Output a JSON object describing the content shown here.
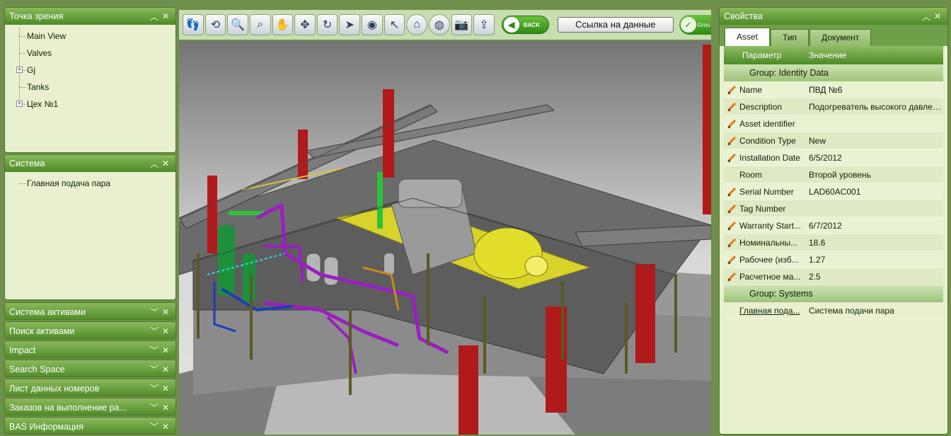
{
  "left_panels": {
    "viewpoints": {
      "title": "Точка зрения",
      "items": [
        {
          "label": "Main View",
          "expandable": false
        },
        {
          "label": "Valves",
          "expandable": false
        },
        {
          "label": "Gj",
          "expandable": true
        },
        {
          "label": "Tanks",
          "expandable": false
        },
        {
          "label": "Цех №1",
          "expandable": true
        }
      ]
    },
    "system": {
      "title": "Система",
      "items": [
        {
          "label": "Главная подача пара"
        }
      ]
    },
    "collapsed": [
      "Система активами",
      "Поиск активами",
      "Impact",
      "Search Space",
      "Лист данных номеров",
      "Заказов на выполнение ра...",
      "BAS Информация"
    ]
  },
  "toolbar": {
    "icons": [
      "walk-icon",
      "orbit-icon",
      "zoom-icon",
      "zoom-window-icon",
      "pan-icon",
      "navigate-icon",
      "rotate-icon",
      "select-icon",
      "layers-icon",
      "pointer-icon",
      "home-icon",
      "sphere-icon",
      "camera-icon",
      "export-icon"
    ],
    "back_label": "BACK",
    "data_link_label": "Ссылка на данные",
    "group_label": "Grou"
  },
  "properties": {
    "title": "Свойства",
    "tabs": [
      "Asset",
      "Тип",
      "Документ"
    ],
    "active_tab": 0,
    "columns": {
      "param": "Параметр",
      "value": "Значение"
    },
    "groups": [
      {
        "title": "Group: Identity Data",
        "rows": [
          {
            "key": "Name",
            "value": "ПВД №6",
            "editable": true
          },
          {
            "key": "Description",
            "value": "Подогреватель высокого давлен...",
            "editable": true
          },
          {
            "key": "Asset identifier",
            "value": "",
            "editable": true
          },
          {
            "key": "Condition Type",
            "value": "New",
            "editable": true
          },
          {
            "key": "Installation Date",
            "value": "6/5/2012",
            "editable": true
          },
          {
            "key": "Room",
            "value": "Второй уровень",
            "editable": false
          },
          {
            "key": "Serial Number",
            "value": "LAD60AC001",
            "editable": true
          },
          {
            "key": "Tag Number",
            "value": "",
            "editable": true
          },
          {
            "key": "Warranty Start...",
            "value": "6/7/2012",
            "editable": true
          },
          {
            "key": "Номинальны...",
            "value": "18.6",
            "editable": true
          },
          {
            "key": "Рабочее (изб...",
            "value": "1.27",
            "editable": true
          },
          {
            "key": "Расчетное ма...",
            "value": "2.5",
            "editable": true
          }
        ]
      },
      {
        "title": "Group: Systems",
        "rows": [
          {
            "key": "Главная пода...",
            "value": "Система подачи пара",
            "editable": false,
            "link": true
          }
        ]
      }
    ]
  },
  "colors": {
    "panel_header": "#4d8a26",
    "panel_bg": "#e8f0cf",
    "accent_green": "#2f8a14",
    "steel_red": "#b01a1a",
    "pipe_purple": "#9a1fc0",
    "generator_yellow": "#e2de2a"
  }
}
